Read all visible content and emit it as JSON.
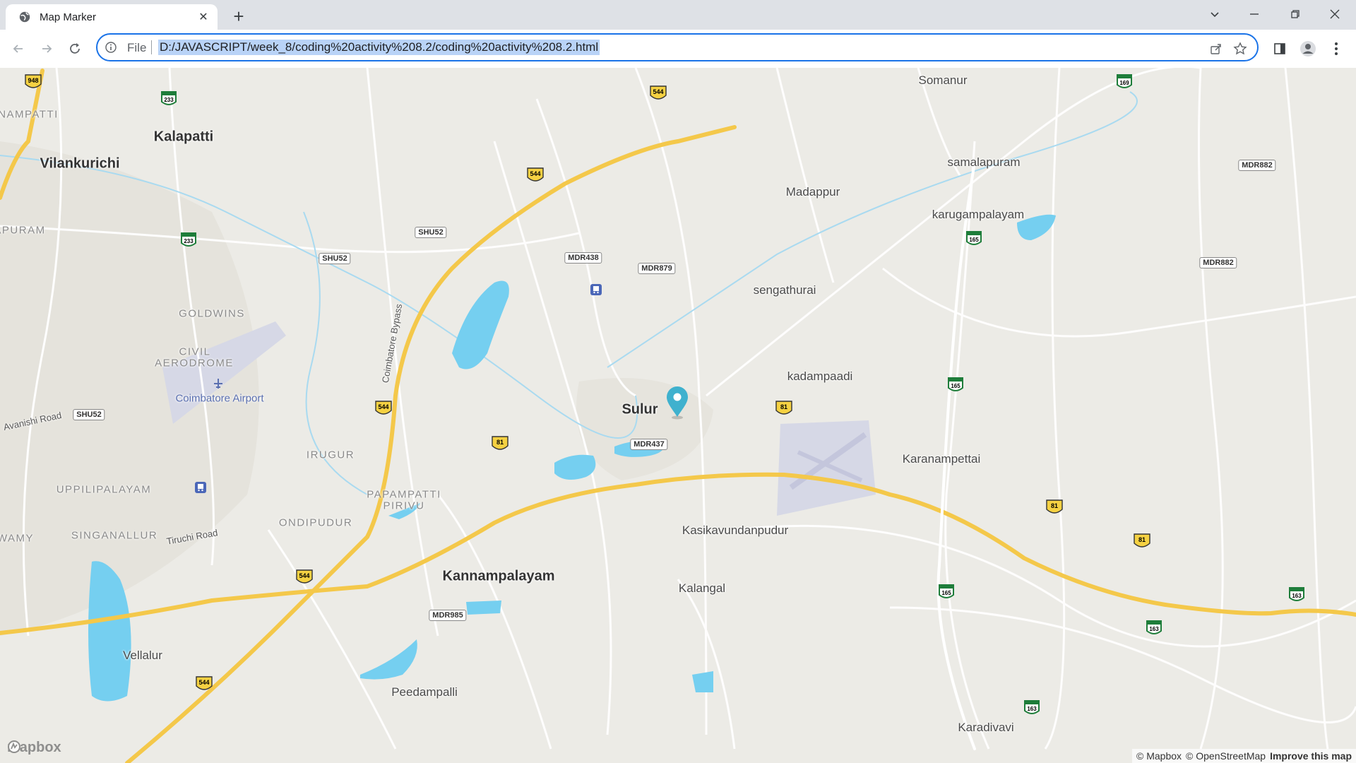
{
  "browser": {
    "tab_title": "Map Marker",
    "scheme_label": "File",
    "url": "D:/JAVASCRIPT/week_8/coding%20activity%208.2/coding%20activity%208.2.html"
  },
  "map": {
    "attribution": {
      "mapbox": "© Mapbox",
      "osm": "© OpenStreetMap",
      "improve": "Improve this map"
    },
    "logo_text": "mapbox",
    "marker_label": "Sulur",
    "places": {
      "somanur": "Somanur",
      "kalapatti": "Kalapatti",
      "vilankurichi": "Vilankurichi",
      "anampatti": "NAMPATTI",
      "apuram": "APURAM",
      "goldwins": "GOLDWINS",
      "civil": "CIVIL",
      "aerodrome": "AERODROME",
      "coimbatore_airport": "Coimbatore Airport",
      "avanishi_road": "Avanishi Road",
      "irugur": "IRUGUR",
      "uppilipalayam": "UPPILIPALAYAM",
      "singanallur": "SINGANALLUR",
      "wamy": "WAMY",
      "tiruchi_road": "Tiruchi Road",
      "ondipudur": "ONDIPUDUR",
      "papampatti": "PAPAMPATTI",
      "pirivu": "PIRIVU",
      "kannampalayam": "Kannampalayam",
      "vellalur": "Vellalur",
      "peedampalli": "Peedampalli",
      "sulur": "Sulur",
      "samalapuram": "samalapuram",
      "madappur": "Madappur",
      "karugampalayam": "karugampalayam",
      "sengathurai": "sengathurai",
      "kadampaadi": "kadampaadi",
      "karanampettai": "Karanampettai",
      "kasikavundanpudur": "Kasikavundanpudur",
      "kalangal": "Kalangal",
      "karadivavi": "Karadivavi",
      "coimbatore_bypass": "Coimbatore Bypass"
    },
    "shields": {
      "nh948": "948",
      "nh233a": "233",
      "nh233b": "233",
      "nh544a": "544",
      "nh544b": "544",
      "nh544c": "544",
      "nh544d": "544",
      "nh544e": "544",
      "nh81a": "81",
      "nh81b": "81",
      "nh81c": "81",
      "nh81d": "81",
      "nh169": "169",
      "nh165a": "165",
      "nh165b": "165",
      "nh165c": "165",
      "nh163a": "163",
      "nh163b": "163",
      "nh163c": "163",
      "shu52a": "SHU52",
      "shu52b": "SHU52",
      "shu52c": "SHU52",
      "mdr438": "MDR438",
      "mdr879": "MDR879",
      "mdr437": "MDR437",
      "mdr985": "MDR985",
      "mdr882a": "MDR882",
      "mdr882b": "MDR882"
    },
    "colors": {
      "water": "#75cff0",
      "road_major": "#f4c84a",
      "road_minor": "#ffffff",
      "marker": "#3fb1ce",
      "background": "#ecebe6"
    }
  }
}
